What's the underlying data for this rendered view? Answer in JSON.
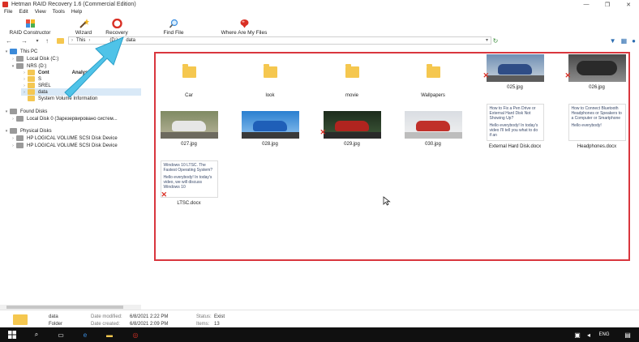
{
  "window": {
    "title": "Hetman RAID Recovery 1.6 (Commercial Edition)",
    "controls": [
      "—",
      "❐",
      "✕"
    ]
  },
  "menu": [
    "File",
    "Edit",
    "View",
    "Tools",
    "Help"
  ],
  "toolbar": {
    "raid_constructor": "RAID Constructor",
    "wizard": "Wizard",
    "recovery": "Recovery",
    "find_file": "Find File",
    "where_are_my_files": "Where Are My Files"
  },
  "address": {
    "crumb1": "This",
    "crumb2": "(D:)",
    "crumb3": "data"
  },
  "tree": {
    "this_pc": "This PC",
    "local_c": "Local Disk (C:)",
    "nrs_d": "NRS (D:)",
    "cont": "Cont",
    "analysis": "Analysis",
    "s": "S",
    "srel": "SREL",
    "data": "data",
    "svi": "System Volume Information",
    "found_disks": "Found Disks",
    "local_0": "Local Disk 0 (Зарезервировано систем...",
    "physical_disks": "Physical Disks",
    "hp1": "HP LOGICAL VOLUME SCSI Disk Device",
    "hp2": "HP LOGICAL VOLUME SCSI Disk Device"
  },
  "items": {
    "car": "Car",
    "look": "look",
    "movie": "movie",
    "wallpapers": "Wallpapers",
    "f025": "025.jpg",
    "f026": "026.jpg",
    "f027": "027.jpg",
    "f028": "028.jpg",
    "f029": "029.jpg",
    "f030": "030.jpg",
    "ext_hdd": "External Hard Disk.docx",
    "headphones": "Headphones.docx",
    "ltsc": "LTSC.docx"
  },
  "docs": {
    "ext_hdd_p1": "How to Fix a Pen Drive or External Hard Disk Not Showing Up?",
    "ext_hdd_p2": "Hello everybody! In today's video I'll tell you what to do if an",
    "headphones_p1": "How to Connect Bluetooth Headphones or Speakers to a Computer or Smartphone",
    "headphones_p2": "Hello everybody!",
    "ltsc_p1": "Windows 10 LTSC. The Fastest Operating System?",
    "ltsc_p2": "Hello everybody! In today's video, we will discuss Windows 10"
  },
  "status": {
    "name": "data",
    "type": "Folder",
    "modified_k": "Date modified:",
    "modified_v": "6/8/2021 2:22 PM",
    "created_k": "Date created:",
    "created_v": "6/8/2021 2:09 PM",
    "status_k": "Status:",
    "status_v": "Exist",
    "items_k": "Items:",
    "items_v": "13"
  },
  "taskbar": {
    "lang": "ENG"
  },
  "colors": {
    "highlight_border": "#d9363e",
    "arrow": "#4fc3e8",
    "folder": "#f5c74f",
    "deleted_mark": "#d93025"
  }
}
